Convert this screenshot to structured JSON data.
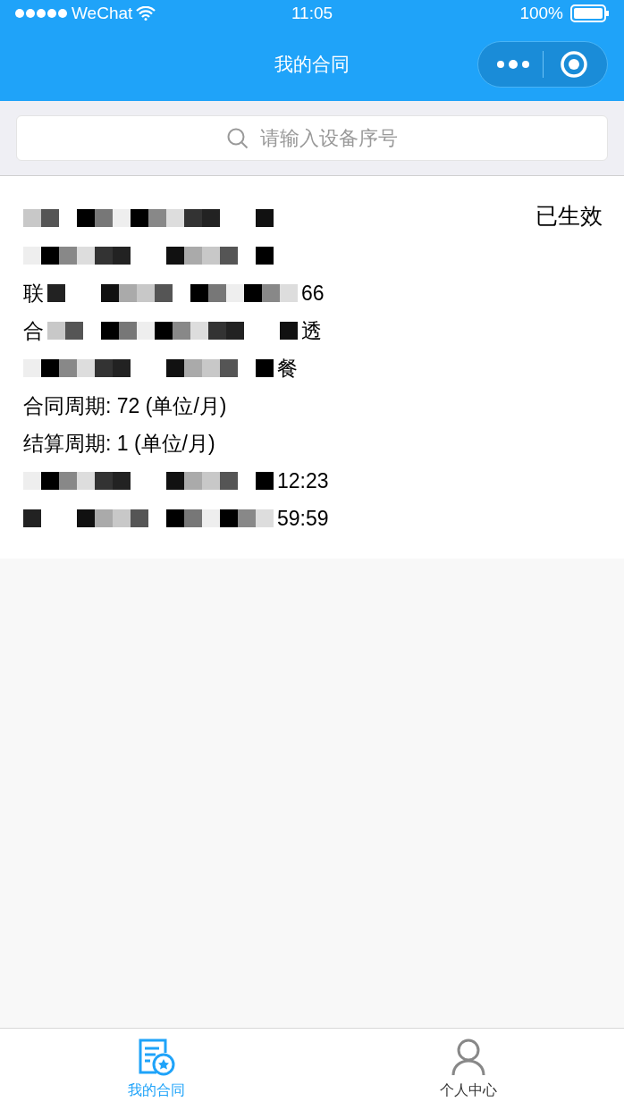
{
  "status_bar": {
    "carrier": "WeChat",
    "time": "11:05",
    "battery": "100%"
  },
  "nav": {
    "title": "我的合同"
  },
  "search": {
    "placeholder": "请输入设备序号"
  },
  "contract": {
    "status": "已生效",
    "rows": [
      {
        "kind": "redacted"
      },
      {
        "kind": "redacted"
      },
      {
        "kind": "redacted",
        "lead": "联",
        "tail": "66"
      },
      {
        "kind": "redacted",
        "lead": "合",
        "tail": "透"
      },
      {
        "kind": "redacted",
        "tail": "餐"
      },
      {
        "kind": "text",
        "text": "合同周期: 72 (单位/月)"
      },
      {
        "kind": "text",
        "text": "结算周期: 1 (单位/月)"
      },
      {
        "kind": "redacted",
        "tail": "12:23"
      },
      {
        "kind": "redacted",
        "tail": "59:59"
      }
    ]
  },
  "tabbar": [
    {
      "label": "我的合同",
      "selected": true,
      "kind": "contract"
    },
    {
      "label": "个人中心",
      "selected": false,
      "kind": "person"
    }
  ]
}
